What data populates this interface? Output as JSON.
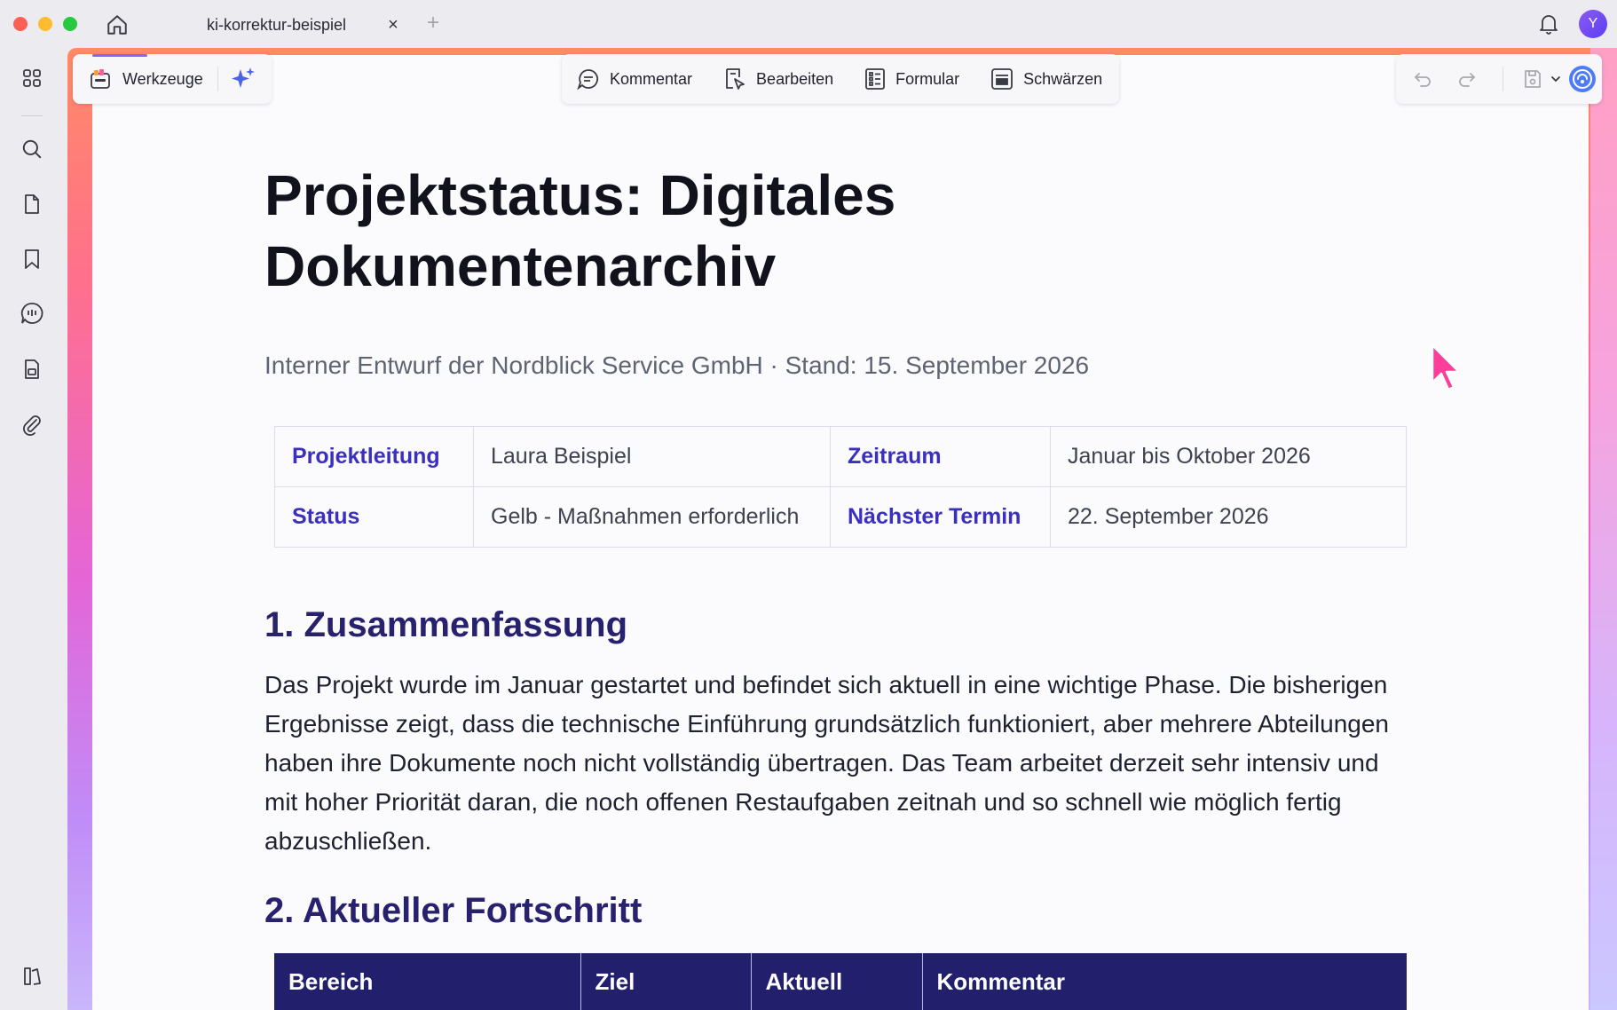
{
  "window": {
    "tab_title": "ki-korrektur-beispiel",
    "tab_close": "×",
    "tab_add": "+",
    "avatar_initial": "Y"
  },
  "toolbar": {
    "tools_label": "Werkzeuge",
    "modes": [
      "Kommentar",
      "Bearbeiten",
      "Formular",
      "Schwärzen"
    ]
  },
  "document": {
    "title": "Projektstatus: Digitales Dokumentenarchiv",
    "subtitle": "Interner Entwurf der Nordblick Service GmbH · Stand: 15. September 2026",
    "info": [
      [
        {
          "key": "Projektleitung",
          "value": "Laura Beispiel"
        },
        {
          "key": "Zeitraum",
          "value": "Januar bis Oktober 2026"
        }
      ],
      [
        {
          "key": "Status",
          "value": "Gelb - Maßnahmen erforderlich"
        },
        {
          "key": "Nächster Termin",
          "value": "22. September 2026"
        }
      ]
    ],
    "section1_heading": "1. Zusammenfassung",
    "section1_text": "Das Projekt wurde im Januar gestartet und befindet sich aktuell in eine wichtige Phase. Die bisherigen Ergebnisse zeigt, dass die technische Einführung grundsätzlich funktioniert, aber mehrere Abteilungen haben ihre Dokumente noch nicht vollständig übertragen. Das Team arbeitet derzeit sehr intensiv und mit hoher Priorität daran, die noch offenen Restaufgaben zeitnah und so schnell wie möglich fertig abzuschließen.",
    "section2_heading": "2. Aktueller Fortschritt",
    "progress_headers": [
      "Bereich",
      "Ziel",
      "Aktuell",
      "Kommentar"
    ]
  },
  "colors": {
    "accent": "#3b2fbf",
    "heading": "#27216e",
    "table_header": "#22206d",
    "cursor": "#ff3d9a"
  },
  "icons": {
    "home": "home-icon",
    "bell": "bell-icon",
    "sidebar": [
      "grid-icon",
      "search-icon",
      "page-icon",
      "bookmark-icon",
      "comment-icon",
      "stamp-icon",
      "paperclip-icon",
      "sidebar-toggle-icon"
    ],
    "tools": "toolbox-icon",
    "ai": "sparkle-icon",
    "modes": [
      "comment-icon",
      "edit-icon",
      "form-icon",
      "redact-icon"
    ],
    "right": [
      "undo-icon",
      "redo-icon",
      "save-icon",
      "chevron-down-icon",
      "ai-assistant-icon"
    ]
  }
}
